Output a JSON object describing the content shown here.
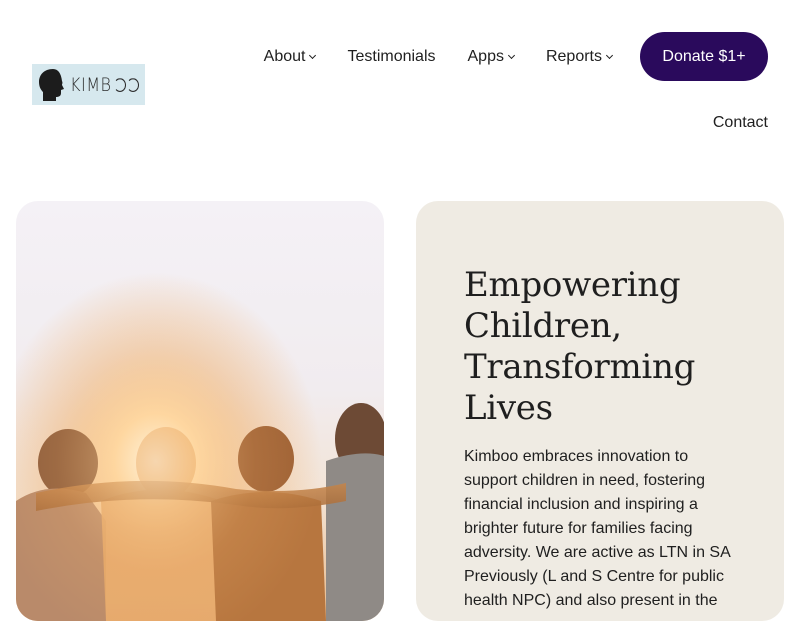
{
  "header": {
    "logo_text": "KIMB",
    "nav": {
      "about": "About",
      "testimonials": "Testimonials",
      "apps": "Apps",
      "reports": "Reports",
      "donate": "Donate $1+",
      "contact": "Contact"
    }
  },
  "hero": {
    "image_icon": "children-embracing-photo",
    "headline": "Empowering Children, Transforming Lives",
    "body": "Kimboo embraces innovation to support children in need, fostering financial inclusion and inspiring a brighter future for families facing adversity. We are active as LTN in SA Previously (L and S Centre for public health NPC) and also present in the"
  },
  "colors": {
    "donate_bg": "#2a0a5c",
    "card_bg": "#efebe3",
    "logo_bg": "#d6e8ee"
  }
}
